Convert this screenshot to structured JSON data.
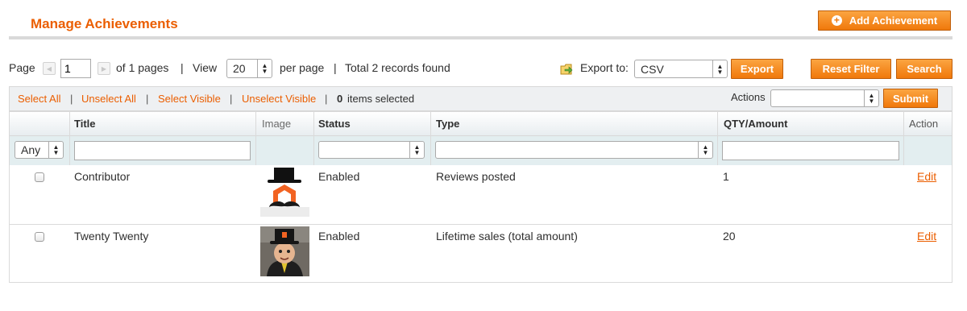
{
  "header": {
    "title": "Manage Achievements",
    "add_label": "Add Achievement"
  },
  "pager": {
    "page_label": "Page",
    "page_value": "1",
    "of_pages": "of 1 pages",
    "sep1": "|",
    "view_label": "View",
    "per_page_value": "20",
    "per_page_label": "per page",
    "sep2": "|",
    "total": "Total 2 records found"
  },
  "export": {
    "label": "Export to:",
    "format": "CSV",
    "button": "Export"
  },
  "filters": {
    "reset_label": "Reset Filter",
    "search_label": "Search"
  },
  "massaction": {
    "select_all": "Select All",
    "unselect_all": "Unselect All",
    "select_visible": "Select Visible",
    "unselect_visible": "Unselect Visible",
    "sep": "|",
    "count": "0",
    "count_label": "items selected",
    "actions_label": "Actions",
    "submit_label": "Submit"
  },
  "columns": {
    "title": "Title",
    "image": "Image",
    "status": "Status",
    "type": "Type",
    "qty": "QTY/Amount",
    "action": "Action"
  },
  "filter_values": {
    "any": "Any"
  },
  "rows": [
    {
      "title": "Contributor",
      "status": "Enabled",
      "type": "Reviews posted",
      "qty": "1",
      "action": "Edit",
      "image_icon": "top-hat-mustache-logo-icon"
    },
    {
      "title": "Twenty Twenty",
      "status": "Enabled",
      "type": "Lifetime sales (total amount)",
      "qty": "20",
      "action": "Edit",
      "image_icon": "top-hat-character-icon"
    }
  ],
  "colors": {
    "accent": "#eb5e00",
    "button": "#f0780b"
  }
}
